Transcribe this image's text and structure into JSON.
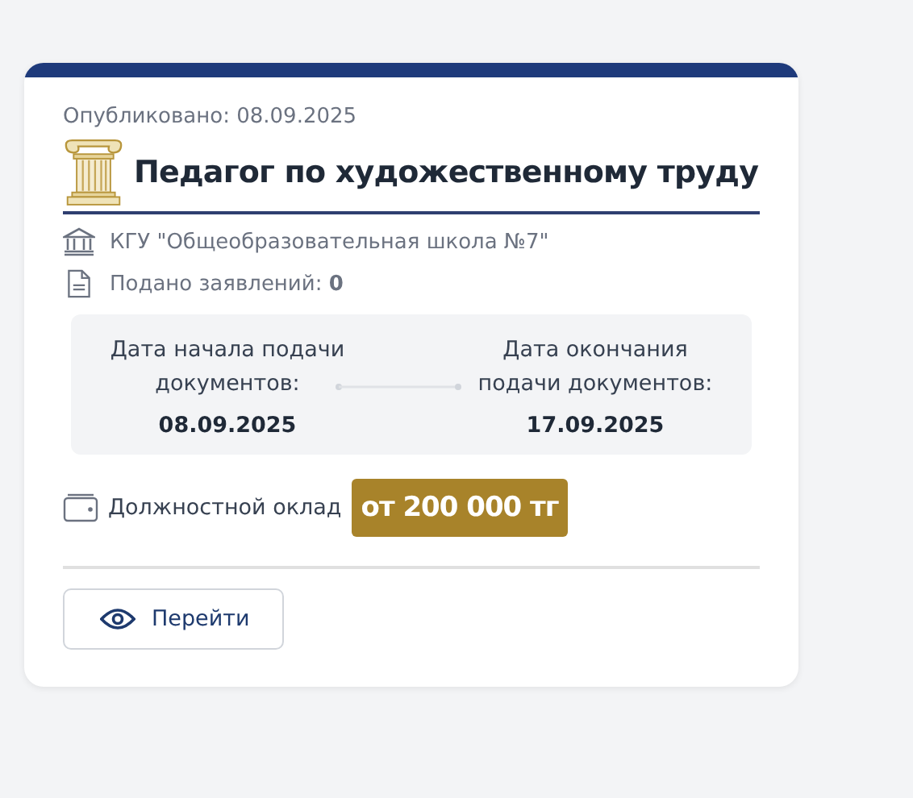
{
  "published": "Опубликовано: 08.09.2025",
  "title": "Педагог по художественному труду",
  "organization": "КГУ \"Общеобразовательная школа №7\"",
  "applications": "Подано заявлений: **0**",
  "dates": [
    {
      "label": "Дата начала подачи документов:",
      "value": "08.09.2025"
    },
    {
      "label": "Дата окончания подачи документов:",
      "value": "17.09.2025"
    }
  ],
  "salary": {
    "label": "Должностной оклад",
    "value": "от 200 000 тг"
  },
  "button": "Перейти"
}
